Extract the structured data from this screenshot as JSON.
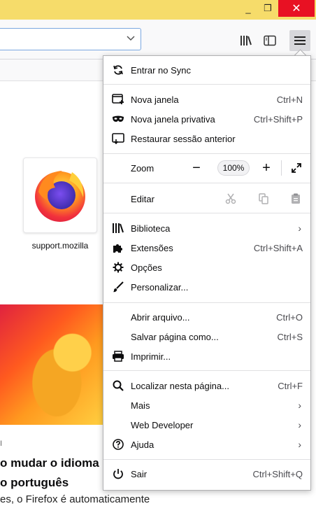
{
  "window": {
    "minimize_glyph": "_",
    "maximize_glyph": "❐",
    "close_glyph": "✕"
  },
  "newtab": {
    "tile_label": "support.mozilla",
    "article_tick": "I",
    "article_title_1": "o mudar o idioma",
    "article_title_2": "o português",
    "article_snippet": "es, o Firefox é automaticamente"
  },
  "menu": {
    "sync": "Entrar no Sync",
    "new_window": {
      "label": "Nova janela",
      "shortcut": "Ctrl+N"
    },
    "private_window": {
      "label": "Nova janela privativa",
      "shortcut": "Ctrl+Shift+P"
    },
    "restore_session": "Restaurar sessão anterior",
    "zoom": {
      "label": "Zoom",
      "minus": "−",
      "value": "100%",
      "plus": "+"
    },
    "edit": "Editar",
    "library": "Biblioteca",
    "addons": {
      "label": "Extensões",
      "shortcut": "Ctrl+Shift+A"
    },
    "options": "Opções",
    "customize": "Personalizar...",
    "open_file": {
      "label": "Abrir arquivo...",
      "shortcut": "Ctrl+O"
    },
    "save_page": {
      "label": "Salvar página como...",
      "shortcut": "Ctrl+S"
    },
    "print": "Imprimir...",
    "find": {
      "label": "Localizar nesta página...",
      "shortcut": "Ctrl+F"
    },
    "more": "Mais",
    "web_developer": "Web Developer",
    "help": "Ajuda",
    "quit": {
      "label": "Sair",
      "shortcut": "Ctrl+Shift+Q"
    },
    "chevron": "›"
  },
  "colors": {
    "titlebar": "#f6dc6a",
    "close": "#e81123",
    "menu_border": "#b1b1b3"
  }
}
